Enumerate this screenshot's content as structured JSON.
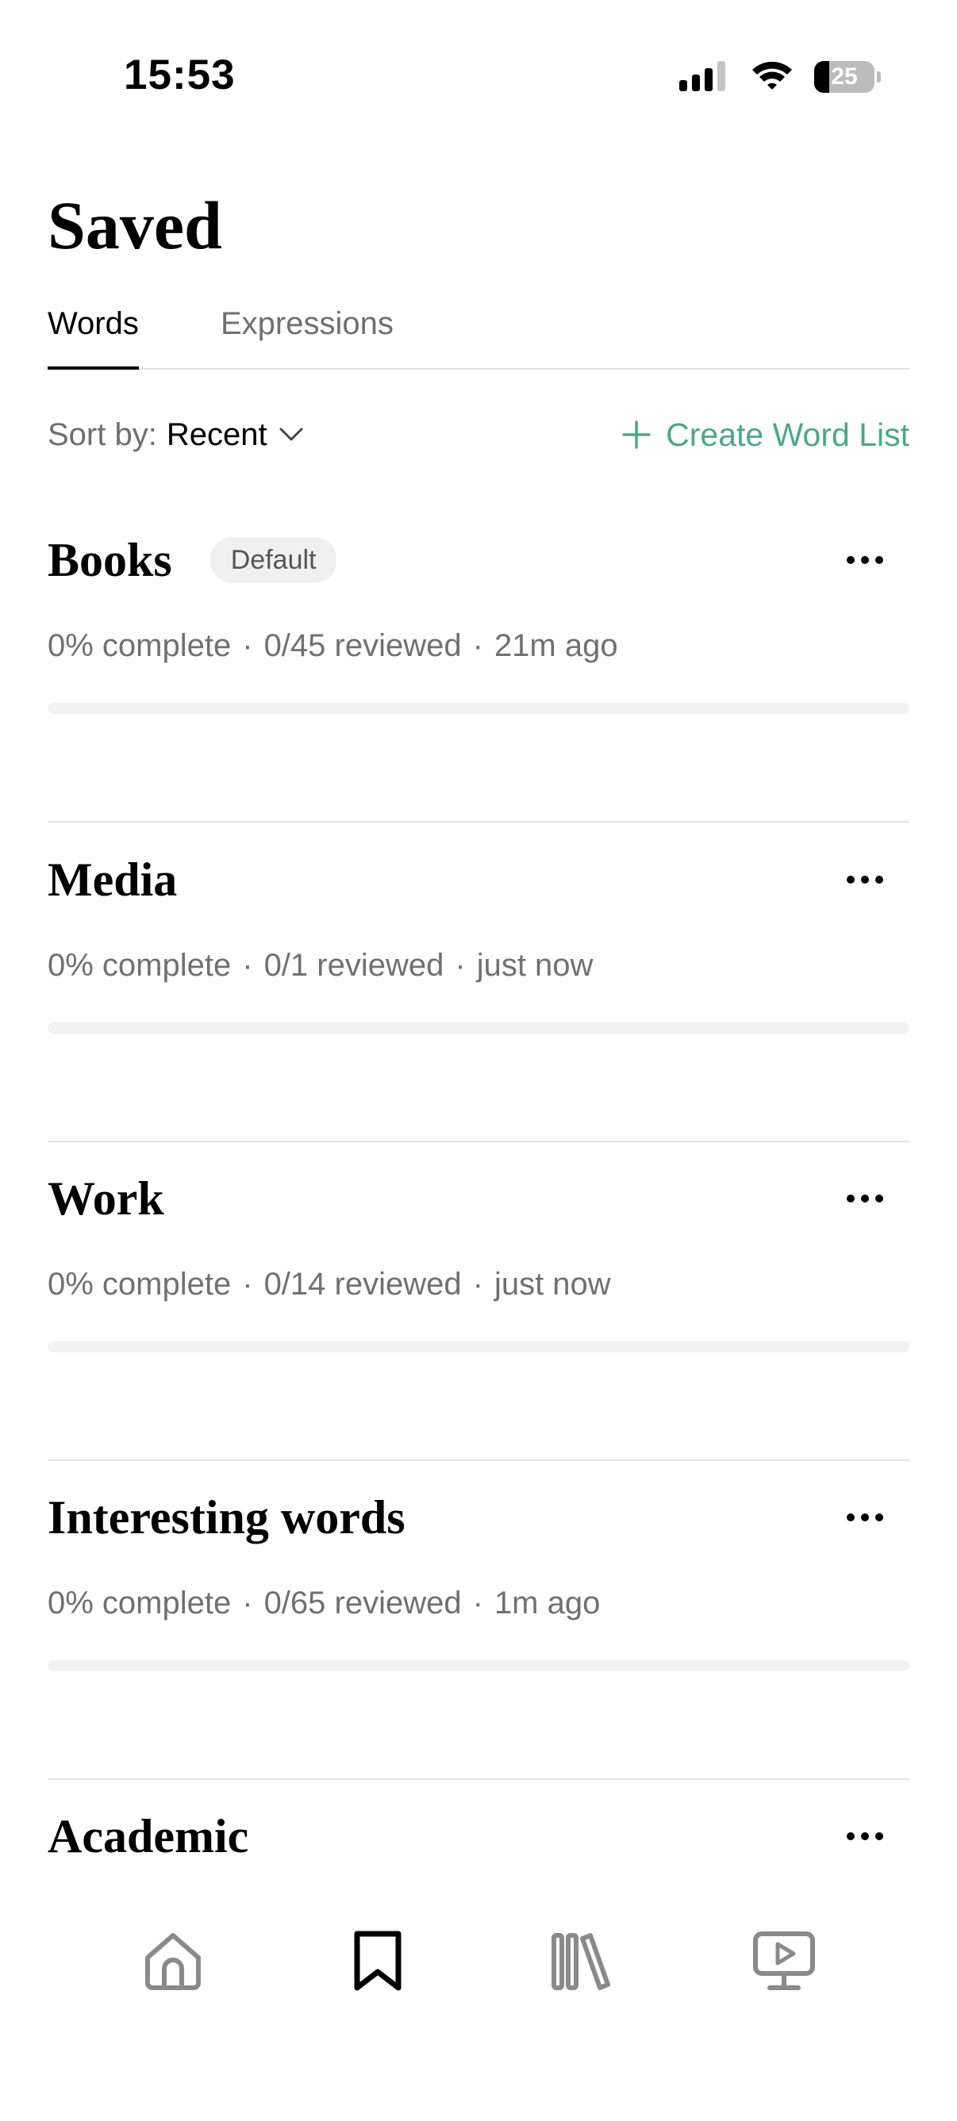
{
  "status_bar": {
    "time": "15:53",
    "battery_level": "25",
    "icons": [
      "cellular-signal-icon",
      "wifi-icon",
      "battery-icon"
    ]
  },
  "header": {
    "title": "Saved"
  },
  "tabs": [
    {
      "label": "Words",
      "active": true
    },
    {
      "label": "Expressions",
      "active": false
    }
  ],
  "toolbar": {
    "sort_label": "Sort by:",
    "sort_value": "Recent",
    "create_label": "Create Word List"
  },
  "word_lists": [
    {
      "title": "Books",
      "badge": "Default",
      "complete": "0% complete",
      "reviewed": "0/45 reviewed",
      "updated": "21m ago",
      "progress": 0
    },
    {
      "title": "Media",
      "badge": "",
      "complete": "0% complete",
      "reviewed": "0/1 reviewed",
      "updated": "just now",
      "progress": 0
    },
    {
      "title": "Work",
      "badge": "",
      "complete": "0% complete",
      "reviewed": "0/14 reviewed",
      "updated": "just now",
      "progress": 0
    },
    {
      "title": "Interesting words",
      "badge": "",
      "complete": "0% complete",
      "reviewed": "0/65 reviewed",
      "updated": "1m ago",
      "progress": 0
    },
    {
      "title": "Academic",
      "badge": "",
      "complete": "",
      "reviewed": "",
      "updated": "",
      "progress": 0
    }
  ],
  "bottom_nav": [
    {
      "icon": "home-icon",
      "active": false
    },
    {
      "icon": "bookmark-icon",
      "active": true
    },
    {
      "icon": "library-icon",
      "active": false
    },
    {
      "icon": "video-player-icon",
      "active": false
    }
  ],
  "colors": {
    "accent": "#4aa88a",
    "muted_text": "#707070",
    "divider": "#e4e4e4",
    "inactive_icon": "#8a8a8a"
  }
}
